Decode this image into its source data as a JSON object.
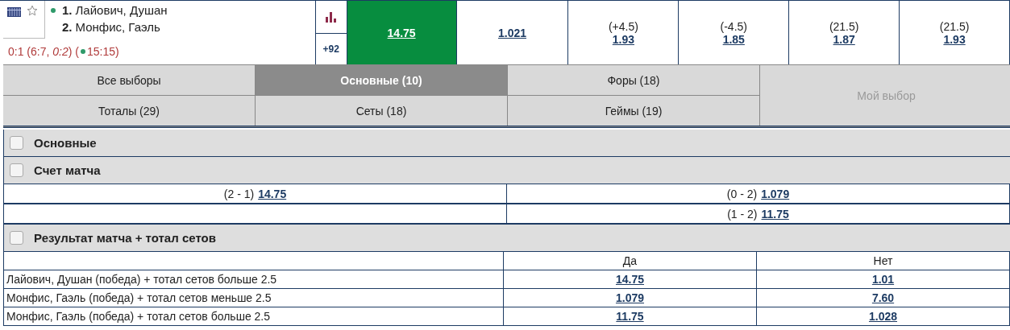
{
  "event": {
    "players": [
      {
        "number": "1.",
        "name": "Лайович, Душан",
        "serving": true
      },
      {
        "number": "2.",
        "name": "Монфис, Гаэль",
        "serving": false
      }
    ],
    "score": "0:1 (6:7, *0:2*) (",
    "live": true,
    "time": "15:15)",
    "favorite": false,
    "more_markets": "+92",
    "odds": [
      {
        "value": "14.75",
        "selected": true
      },
      {
        "value": "1.021",
        "selected": false
      },
      {
        "handicap": "(+4.5)",
        "value": "1.93",
        "selected": false
      },
      {
        "handicap": "(-4.5)",
        "value": "1.85",
        "selected": false
      },
      {
        "handicap": "(21.5)",
        "value": "1.87",
        "selected": false
      },
      {
        "handicap": "(21.5)",
        "value": "1.93",
        "selected": false
      }
    ]
  },
  "tabs": [
    {
      "label": "Все выборы",
      "selected": false,
      "kind": "normal",
      "disabled": false
    },
    {
      "label": "Основные (10)",
      "selected": true,
      "kind": "normal",
      "disabled": false
    },
    {
      "label": "Форы (18)",
      "selected": false,
      "kind": "normal",
      "disabled": false
    },
    {
      "label": "Мой выбор",
      "selected": false,
      "kind": "side",
      "disabled": true
    },
    {
      "label": "Тоталы (29)",
      "selected": false,
      "kind": "normal",
      "disabled": false
    },
    {
      "label": "Сеты (18)",
      "selected": false,
      "kind": "normal",
      "disabled": false
    },
    {
      "label": "Геймы (19)",
      "selected": false,
      "kind": "normal",
      "disabled": false
    }
  ],
  "sections": [
    {
      "title": "Основные",
      "checked": false,
      "kind": "empty"
    },
    {
      "title": "Счет матча",
      "checked": false,
      "kind": "scores",
      "rows": [
        {
          "left": {
            "label": "(2 - 1)",
            "value": "14.75"
          },
          "right": {
            "label": "(0 - 2)",
            "value": "1.079"
          }
        },
        {
          "right": {
            "label": "(1 - 2)",
            "value": "11.75"
          }
        }
      ]
    },
    {
      "title": "Результат матча + тотал сетов",
      "checked": false,
      "kind": "table",
      "columns": [
        "Да",
        "Нет"
      ],
      "rows": [
        {
          "label": "Лайович, Душан (победа) + тотал сетов больше 2.5",
          "values": [
            "14.75",
            "1.01"
          ]
        },
        {
          "label": "Монфис, Гаэль (победа) + тотал сетов меньше 2.5",
          "values": [
            "1.079",
            "7.60"
          ]
        },
        {
          "label": "Монфис, Гаэль (победа) + тотал сетов больше 2.5",
          "values": [
            "11.75",
            "1.028"
          ]
        }
      ]
    }
  ]
}
